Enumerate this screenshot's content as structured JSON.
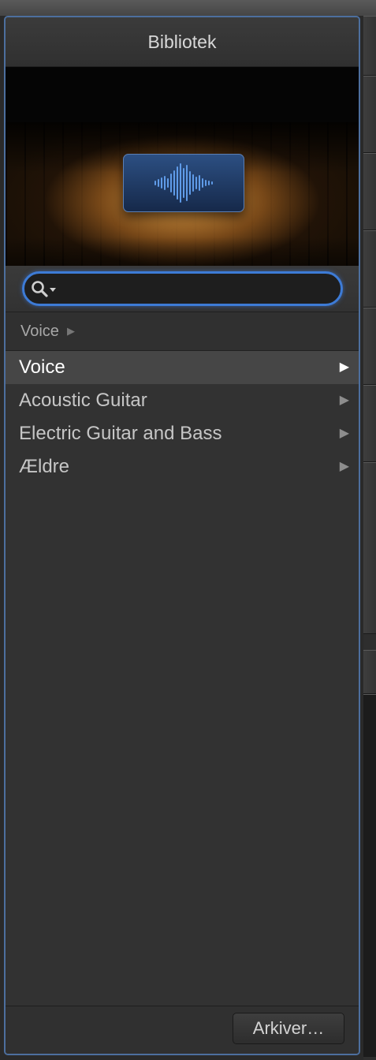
{
  "panel": {
    "title": "Bibliotek"
  },
  "preview": {
    "icon": "audio-waveform-icon"
  },
  "search": {
    "value": "",
    "placeholder": "",
    "icon": "search-icon"
  },
  "breadcrumb": {
    "current": "Voice"
  },
  "list": {
    "items": [
      {
        "label": "Voice",
        "selected": true
      },
      {
        "label": "Acoustic Guitar",
        "selected": false
      },
      {
        "label": "Electric Guitar and Bass",
        "selected": false
      },
      {
        "label": "Ældre",
        "selected": false
      }
    ]
  },
  "footer": {
    "archive_label": "Arkiver…"
  },
  "colors": {
    "accent": "#3d7bd6",
    "panel_border": "#4d6f9e",
    "background": "#323232"
  }
}
